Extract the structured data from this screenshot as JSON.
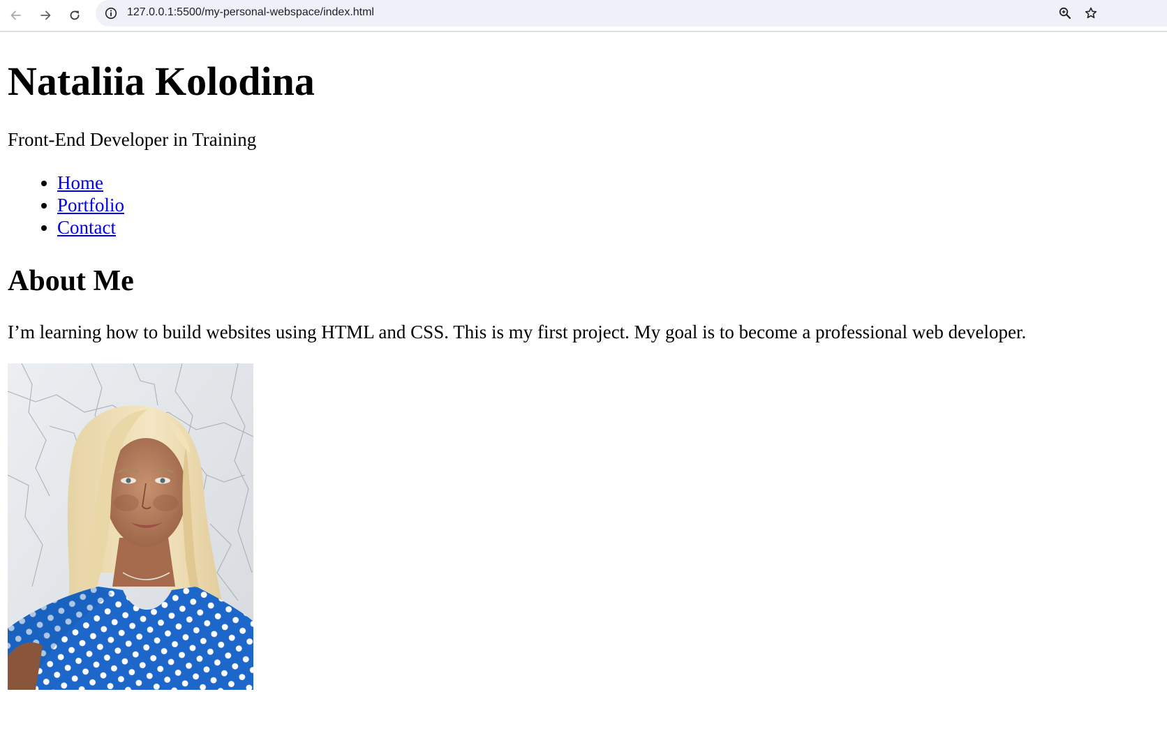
{
  "browser": {
    "url": "127.0.0.1:5500/my-personal-webspace/index.html",
    "icons": {
      "back": "arrow-left-icon",
      "forward": "arrow-right-icon",
      "reload": "reload-icon",
      "site_info": "info-circle-icon",
      "zoom": "zoom-in-icon",
      "bookmark": "star-icon"
    }
  },
  "header": {
    "name": "Nataliia Kolodina",
    "tagline": "Front-End Developer in Training"
  },
  "nav": {
    "items": [
      {
        "label": "Home"
      },
      {
        "label": "Portfolio"
      },
      {
        "label": "Contact"
      }
    ],
    "link_color": "#0000ee"
  },
  "about": {
    "heading": "About Me",
    "text": "I’m learning how to build websites using HTML and CSS. This is my first project. My goal is to become a professional web developer."
  },
  "colors": {
    "omnibox_bg": "#eef1f8",
    "text": "#000000",
    "dress_blue": "#1c67c9"
  }
}
